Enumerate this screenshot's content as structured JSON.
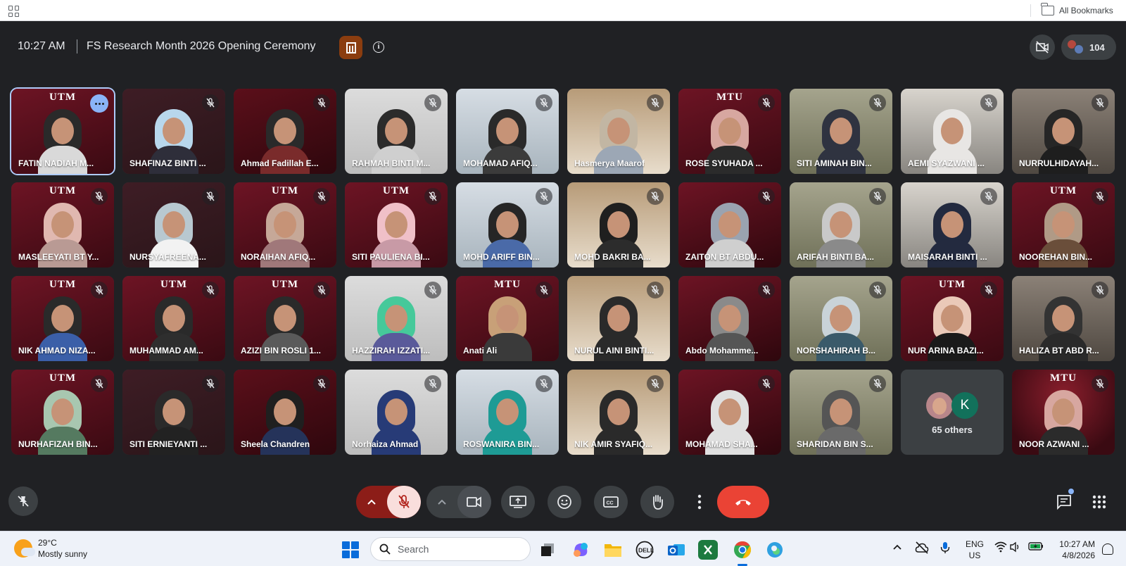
{
  "browser": {
    "bookmarks_label": "All Bookmarks"
  },
  "meeting": {
    "time": "10:27 AM",
    "title": "FS Research Month 2026 Opening Ceremony",
    "participant_count": "104"
  },
  "participants": [
    {
      "name": "FATIN NADIAH M...",
      "muted": false,
      "speaking": true,
      "logo": "UTM"
    },
    {
      "name": "SHAFINAZ BINTI ...",
      "muted": true,
      "logo": ""
    },
    {
      "name": "Ahmad Fadillah E...",
      "muted": true,
      "logo": ""
    },
    {
      "name": "RAHMAH BINTI M...",
      "muted": true,
      "logo": ""
    },
    {
      "name": "MOHAMAD AFIQ...",
      "muted": true,
      "logo": ""
    },
    {
      "name": "Hasmerya Maarof",
      "muted": true,
      "logo": ""
    },
    {
      "name": "ROSE SYUHADA ...",
      "muted": true,
      "logo": "MTU"
    },
    {
      "name": "SITI AMINAH BIN...",
      "muted": true,
      "logo": ""
    },
    {
      "name": "AEMI SYAZWANI ...",
      "muted": true,
      "logo": ""
    },
    {
      "name": "NURRULHIDAYAH...",
      "muted": true,
      "logo": ""
    },
    {
      "name": "MASLEEYATI BT Y...",
      "muted": true,
      "logo": "UTM"
    },
    {
      "name": "NURSYAFREENA...",
      "muted": true,
      "logo": ""
    },
    {
      "name": "NORAIHAN AFIQ...",
      "muted": true,
      "logo": "UTM"
    },
    {
      "name": "SITI PAULIENA BI...",
      "muted": true,
      "logo": "UTM"
    },
    {
      "name": "MOHD ARIFF BIN...",
      "muted": true,
      "logo": ""
    },
    {
      "name": "MOHD BAKRI BA...",
      "muted": true,
      "logo": ""
    },
    {
      "name": "ZAITON BT ABDU...",
      "muted": true,
      "logo": ""
    },
    {
      "name": "ARIFAH BINTI BA...",
      "muted": true,
      "logo": ""
    },
    {
      "name": "MAISARAH BINTI ...",
      "muted": true,
      "logo": ""
    },
    {
      "name": "NOOREHAN BIN...",
      "muted": true,
      "logo": "UTM"
    },
    {
      "name": "NIK AHMAD NIZA...",
      "muted": true,
      "logo": "UTM"
    },
    {
      "name": "MUHAMMAD AM...",
      "muted": true,
      "logo": "UTM"
    },
    {
      "name": "AZIZI BIN ROSLI 1...",
      "muted": true,
      "logo": "UTM"
    },
    {
      "name": "HAZZIRAH IZZATI...",
      "muted": true,
      "logo": ""
    },
    {
      "name": "Anati Ali",
      "muted": true,
      "logo": "MTU"
    },
    {
      "name": "NURUL AINI BINTI...",
      "muted": true,
      "logo": ""
    },
    {
      "name": "Abdo Mohamme...",
      "muted": true,
      "logo": ""
    },
    {
      "name": "NORSHAHIRAH B...",
      "muted": true,
      "logo": ""
    },
    {
      "name": "NUR ARINA BAZI...",
      "muted": true,
      "logo": "UTM"
    },
    {
      "name": "HALIZA BT ABD R...",
      "muted": true,
      "logo": ""
    },
    {
      "name": "NURHAFIZAH BIN...",
      "muted": true,
      "logo": "UTM"
    },
    {
      "name": "SITI ERNIEYANTI ...",
      "muted": true,
      "logo": ""
    },
    {
      "name": "Sheela Chandren",
      "muted": true,
      "logo": ""
    },
    {
      "name": "Norhaiza Ahmad",
      "muted": true,
      "logo": ""
    },
    {
      "name": "ROSWANIRA BIN...",
      "muted": true,
      "logo": ""
    },
    {
      "name": "NIK AMIR SYAFIQ...",
      "muted": true,
      "logo": ""
    },
    {
      "name": "MOHAMAD SHA...",
      "muted": true,
      "logo": ""
    },
    {
      "name": "SHARIDAN BIN S...",
      "muted": true,
      "logo": ""
    }
  ],
  "others": {
    "initial": "K",
    "label": "65 others"
  },
  "last_participant": {
    "name": "NOOR AZWANI ...",
    "muted": true,
    "logo": "MTU"
  },
  "colors": {
    "background": "#202124",
    "tile": "#3c4043",
    "utm_maroon": "#5b0f1a",
    "end_call": "#ea4335",
    "mic_off": "#f9dedc",
    "accent": "#8ab4f8"
  },
  "taskbar": {
    "temperature": "29°C",
    "weather": "Mostly sunny",
    "search_placeholder": "Search",
    "lang_top": "ENG",
    "lang_bottom": "US",
    "clock_time": "10:27 AM",
    "clock_date": "4/8/2026"
  }
}
